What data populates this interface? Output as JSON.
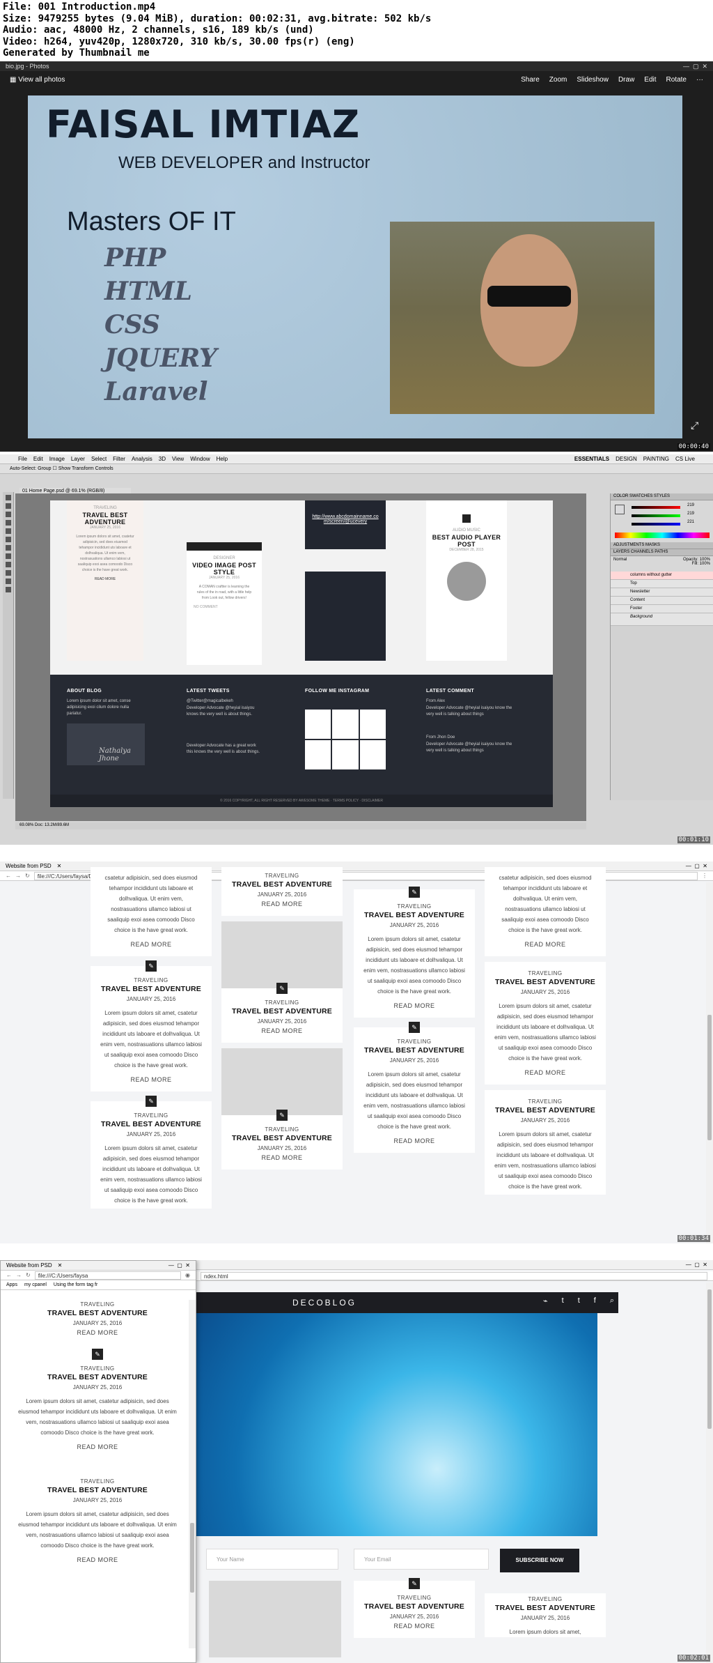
{
  "header": {
    "lines": [
      "File: 001 Introduction.mp4",
      "Size: 9479255 bytes (9.04 MiB), duration: 00:02:31, avg.bitrate: 502 kb/s",
      "Audio: aac, 48000 Hz, 2 channels, s16, 189 kb/s (und)",
      "Video: h264, yuv420p, 1280x720, 310 kb/s, 30.00 fps(r) (eng)",
      "Generated by Thumbnail me"
    ]
  },
  "timestamps": [
    "00:00:40",
    "00:01:10",
    "00:01:34",
    "00:02:01"
  ],
  "photos": {
    "window_title": "bio.jpg - Photos",
    "view_all": "View all photos",
    "tools": [
      "Share",
      "Zoom",
      "Slideshow",
      "Draw",
      "Edit",
      "Rotate"
    ],
    "name": "FAISAL IMTIAZ",
    "role": "WEB DEVELOPER and Instructor",
    "masters": "Masters OF IT",
    "skills": [
      "PHP",
      "HTML",
      "CSS",
      "JQUERY",
      "Laravel"
    ],
    "nav": [
      "←",
      "▭",
      "🗑",
      "→"
    ]
  },
  "photoshop": {
    "menu": [
      "File",
      "Edit",
      "Image",
      "Layer",
      "Select",
      "Filter",
      "Analysis",
      "3D",
      "View",
      "Window",
      "Help"
    ],
    "workspaces": [
      "ESSENTIALS",
      "DESIGN",
      "PAINTING",
      "CS Live"
    ],
    "options": "Auto-Select: Group  ☐ Show Transform Controls",
    "tab": "01 Home Page.psd @ 69.1% (RGB/8)",
    "card1": {
      "cat": "TRAVELING",
      "title": "TRAVEL BEST ADVENTURE",
      "date": "JANUARY 25, 2016",
      "body": "Lorem ipsum dolors sit amet, csatetur adipisicin, sed does eiusmod tehampor incididunt uts laboare et dolhvaliqua. Ut enim vem, nostrasuations ullamco labiosi ut saaliquip exoi asea comoodo Disco choice is the have great work.",
      "more": "READ MORE"
    },
    "card2": {
      "cat": "DESIGNER",
      "title": "VIDEO IMAGE POST STYLE",
      "date": "JANUARY 25, 2016",
      "body": "A COMAN craftter is learning the rules of the in road, with a little help from Look out, fellow drivers!",
      "comment": "NO COMMENT"
    },
    "card3": {
      "link": "http://www.abcdomainname.com/screen/@ucevery"
    },
    "card4": {
      "cat": "AUDIO MUSIC",
      "title": "BEST AUDIO PLAYER POST",
      "date": "DECEMBER 28, 2015"
    },
    "footer": {
      "about_h": "ABOUT BLOG",
      "about": "Lorem ipsum dolor sit amet, conse adipisicing exoi cilum dolore nulla pariatur.",
      "signature": "Nathalya Jhone",
      "tweets_h": "LATEST TWEETS",
      "tw_handle": "@Twitter@magicalbekeh",
      "tw1": "Developer Advocate @heyial isaiyou knows the very well is about things.",
      "tw2": "Developer Advocate has a great work this knows the very well is about things.",
      "insta_h": "FOLLOW ME INSTAGRAM",
      "comment_h": "LATEST COMMENT",
      "c1_from": "From Alex",
      "c1": "Developer Advocate @heyial isaiyou know the very well is talking about things",
      "c2_from": "From Jhon Doe",
      "c2": "Developer Advocate @heyial isaiyou know the very well is talking about things",
      "copyright": "© 2016 COPYRIGHT, ALL RIGHT RESERVED BY AWESOME THEME  ·  TERMS POLICY  ·  DISCLAIMER"
    },
    "panels": {
      "color": "COLOR",
      "swatches": "SWATCHES",
      "styles": "STYLES",
      "adjustments": "ADJUSTMENTS",
      "masks": "MASKS",
      "layers": "LAYERS",
      "channels": "CHANNELS",
      "paths": "PATHS",
      "blend": "Normal",
      "opacity": "Opacity: 100%",
      "fill": "Fill: 100%",
      "rgb": [
        "219",
        "219",
        "221"
      ]
    },
    "layers": [
      "columns without gutter",
      "Top",
      "Newsletter",
      "Content",
      "Footer",
      "Background"
    ],
    "status": "69.08%   Doc: 13.2M/89.6M"
  },
  "browser1": {
    "tab": "Website from PSD",
    "url": "file:///C:/Users/faysa/Desktop/psd%20to%20html/index.html",
    "cat": "TRAVELING",
    "title": "TRAVEL BEST ADVENTURE",
    "date": "JANUARY 25, 2016",
    "body": "Lorem ipsum dolors sit amet, csatetur adipisicin, sed does eiusmod tehampor incididunt uts laboare et dolhvaliqua. Ut enim vem, nostrasuations ullamco labiosi ut saaliquip exoi asea comoodo Disco choice is the have great work.",
    "body_top": "csatetur adipisicin, sed does eiusmod tehampor incididunt uts laboare et dolhvaliqua. Ut enim vem, nostrasuations ullamco labiosi ut saaliquip exoi asea comoodo Disco choice is the have great work.",
    "read": "READ  MORE"
  },
  "browser2": {
    "tab": "Website from PSD",
    "url": "file:///C:/Users/faysa",
    "url_right": "ndex.html",
    "bookmarks": [
      "Apps",
      "my cpanel",
      "Using the form tag fr"
    ],
    "logo": "DECOBLOG",
    "social": [
      "⌁",
      "t",
      "t",
      "f",
      "⌕"
    ],
    "name_ph": "Your Name",
    "email_ph": "Your Email",
    "subscribe": "SUBSCRIBE NOW",
    "body": "Lorem ipsum dolors sit amet, csatetur adipisicin, sed does eiusmod tehampor incididunt uts laboare et dolhvaliqua. Ut enim vem, nostrasuations ullamco labiosi ut saaliquip exoi asea comoodo Disco choice is the have great work.",
    "body2": "Lorem ipsum dolors sit amet, csatetur adipisicin, sed does eiusmod tehampor incididunt uts laboare et dolhvaliqua. Ut enim vem, nostrasuations ullamco labiosi ut saaliquip exoi asea comoodo Disco choice is the have great work.",
    "body_short": "Lorem ipsum dolors sit amet,"
  }
}
